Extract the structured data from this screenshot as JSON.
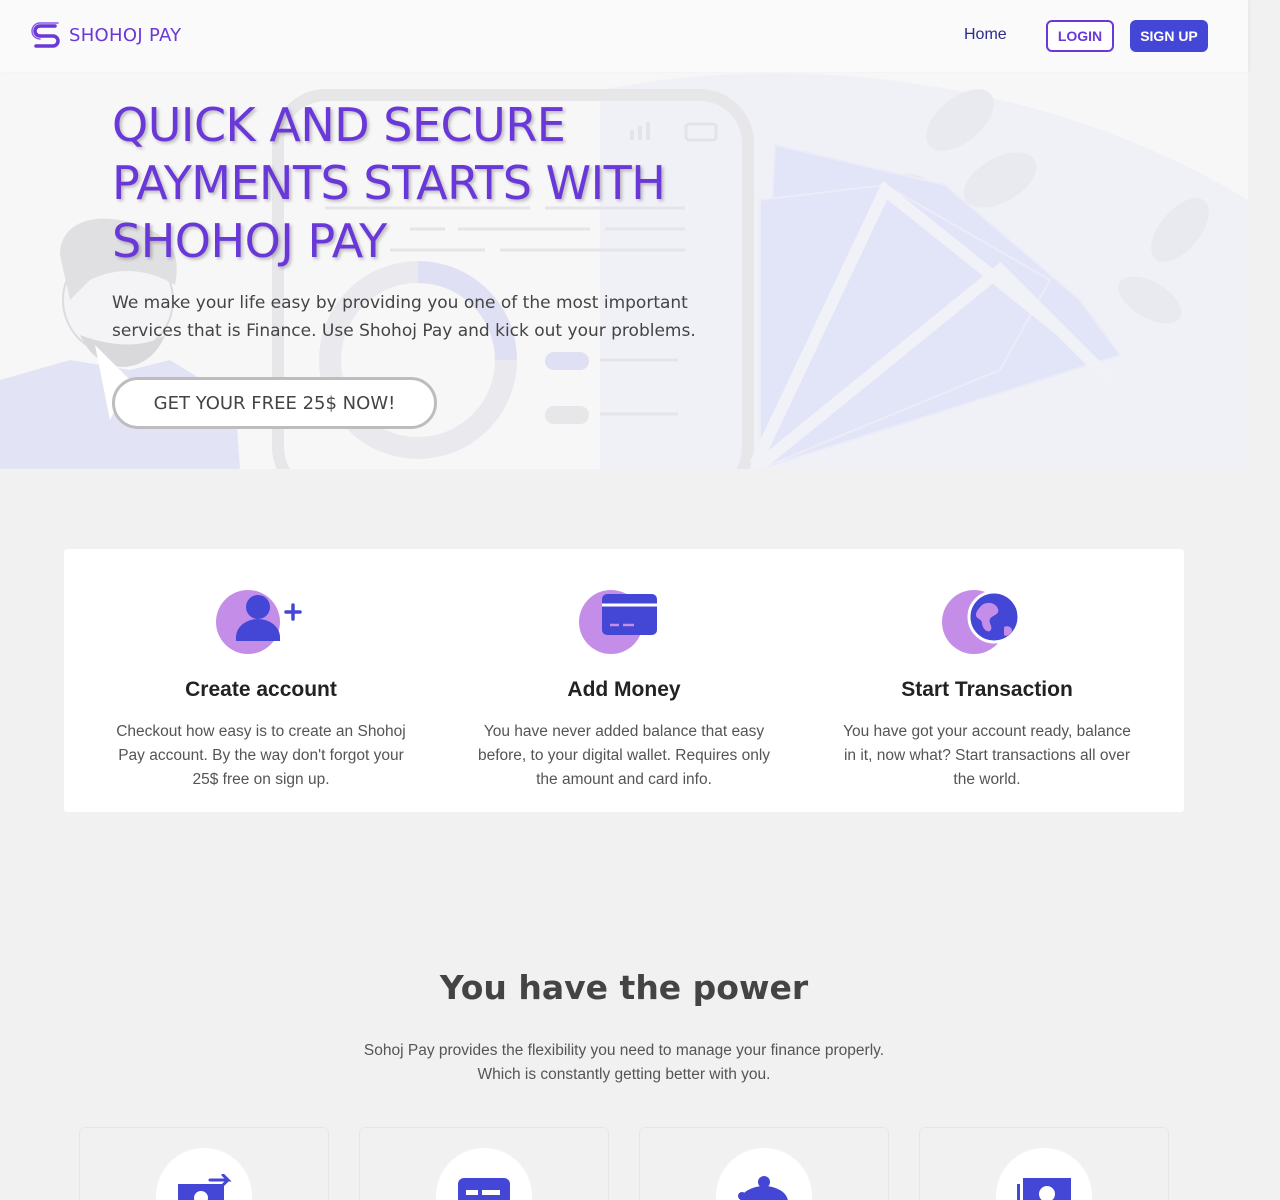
{
  "brand": {
    "name": "SHOHOJ PAY",
    "logo_icon": "s-logo-icon",
    "color": "#6a38d8"
  },
  "nav": {
    "home": "Home",
    "login": "LOGIN",
    "signup": "SIGN UP"
  },
  "hero": {
    "title": "QUICK AND SECURE PAYMENTS STARTS WITH SHOHOJ PAY",
    "subtitle": "We make your life easy by providing you one of the most important services that is Finance. Use Shohoj Pay and kick out your problems.",
    "cta": "GET YOUR FREE 25$ NOW!"
  },
  "features": [
    {
      "icon": "add-user-icon",
      "title": "Create account",
      "text": "Checkout how easy is to create an Shohoj Pay account. By the way don't forgot your 25$ free on sign up."
    },
    {
      "icon": "credit-card-icon",
      "title": "Add Money",
      "text": "You have never added balance that easy before, to your digital wallet. Requires only the amount and card info."
    },
    {
      "icon": "globe-icon",
      "title": "Start Transaction",
      "text": "You have got your account ready, balance in it, now what? Start transactions all over the world."
    }
  ],
  "power": {
    "title": "You have the power",
    "subtitle_line1": "Sohoj Pay provides the flexibility you need to manage your finance properly.",
    "subtitle_line2": "Which is constantly getting better with you.",
    "cards": [
      {
        "icon": "money-transfer-icon"
      },
      {
        "icon": "card-icon"
      },
      {
        "icon": "piggy-bank-icon"
      },
      {
        "icon": "cash-icon"
      }
    ]
  },
  "colors": {
    "accent": "#6a38d8",
    "primary": "#4447d6",
    "lilac": "#c48ee8"
  }
}
